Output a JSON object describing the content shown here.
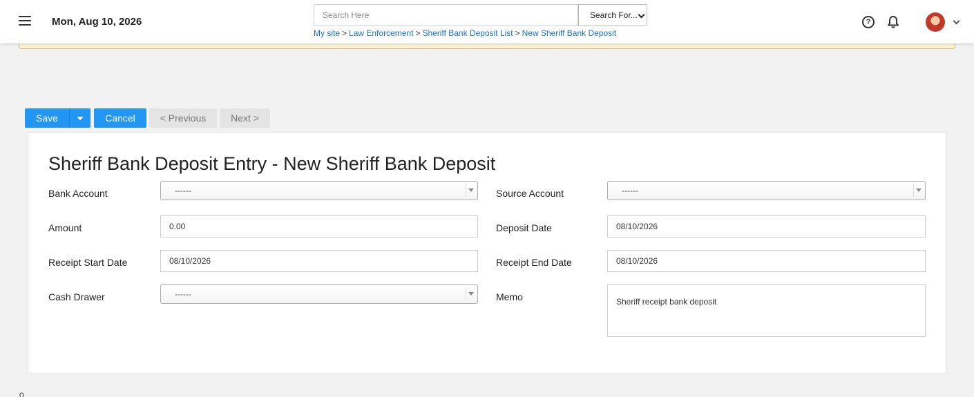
{
  "header": {
    "date": "Mon, Aug 10, 2026",
    "search_placeholder": "Search Here",
    "search_for_label": "Search For...",
    "breadcrumb": [
      "My site",
      "Law Enforcement",
      "Sheriff Bank Deposit List",
      "New Sheriff Bank Deposit"
    ],
    "breadcrumb_separator": ">",
    "help_icon_glyph": "?"
  },
  "toolbar": {
    "save_label": "Save",
    "cancel_label": "Cancel",
    "previous_label": "< Previous",
    "next_label": "Next >"
  },
  "form": {
    "title": "Sheriff Bank Deposit Entry - New Sheriff Bank Deposit",
    "bank_account": {
      "label": "Bank Account",
      "value": "------"
    },
    "source_account": {
      "label": "Source Account",
      "value": "------"
    },
    "amount": {
      "label": "Amount",
      "value": "0.00"
    },
    "deposit_date": {
      "label": "Deposit Date",
      "value": "08/10/2026"
    },
    "receipt_start_date": {
      "label": "Receipt Start Date",
      "value": "08/10/2026"
    },
    "receipt_end_date": {
      "label": "Receipt End Date",
      "value": "08/10/2026"
    },
    "cash_drawer": {
      "label": "Cash Drawer",
      "value": "------"
    },
    "memo": {
      "label": "Memo",
      "value": "Sheriff receipt bank deposit"
    }
  },
  "footer": {
    "text": "0"
  },
  "colors": {
    "primary": "#2196f3",
    "link": "#1a73c9",
    "notice_bg": "#fcf2d6",
    "notice_border": "#d8b76a"
  }
}
